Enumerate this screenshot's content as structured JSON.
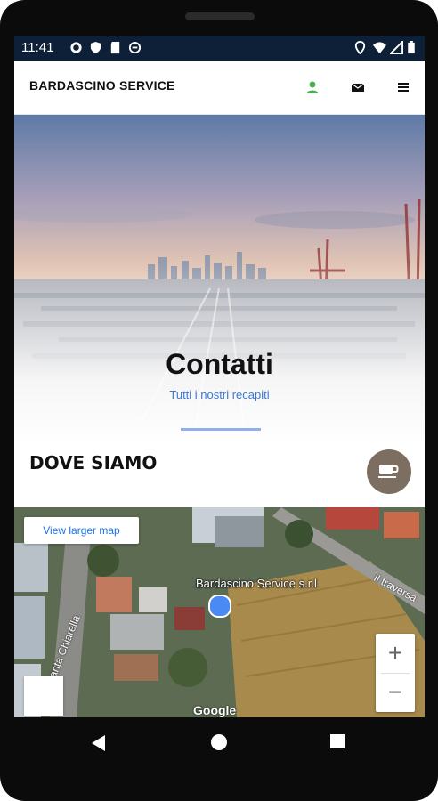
{
  "status_bar": {
    "time": "11:41"
  },
  "app_bar": {
    "title": "BARDASCINO SERVICE",
    "icons": [
      "user-icon",
      "envelope-icon",
      "menu-icon"
    ],
    "user_icon_color": "#4caf50"
  },
  "hero": {
    "title": "Contatti",
    "subtitle": "Tutti i nostri recapiti"
  },
  "section": {
    "title": "DOVE SIAMO"
  },
  "fab": {
    "icon": "coffee-cup-icon",
    "color": "#7d6e62"
  },
  "map": {
    "larger_map_link": "View larger map",
    "place_label": "Bardascino Service s.r.l",
    "road_label_right": "Il traversa",
    "road_label_left": "anta Chiarella",
    "zoom_in": "+",
    "zoom_out": "−",
    "attribution": "Google"
  },
  "colors": {
    "status_bar": "#0d2037",
    "accent": "#3a78d8"
  }
}
